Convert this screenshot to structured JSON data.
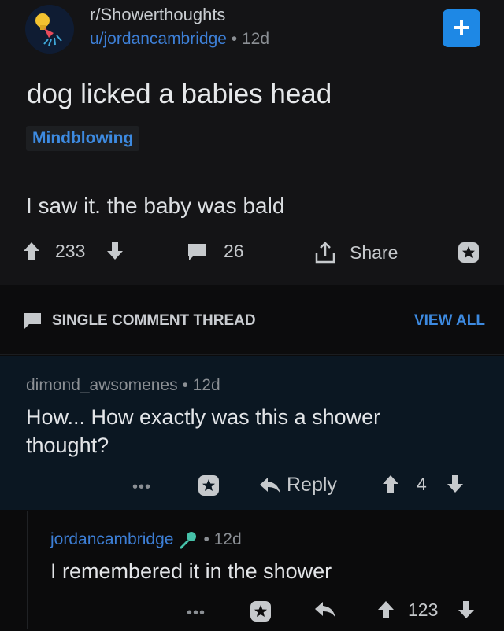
{
  "post": {
    "subreddit": "r/Showerthoughts",
    "username": "u/jordancambridge",
    "age": "• 12d",
    "add_label": "+",
    "title": "dog licked a babies head",
    "flair": "Mindblowing",
    "body": "I saw it. the baby was bald",
    "upvotes": "233",
    "comments": "26",
    "share_label": "Share"
  },
  "thread_bar": {
    "label": "SINGLE COMMENT THREAD",
    "view_all": "VIEW ALL"
  },
  "comment1": {
    "author": "dimond_awsomenes",
    "age": "• 12d",
    "text_line1": "How... How exactly was this a shower",
    "text_line2": "thought?",
    "more": "•••",
    "reply_label": "Reply",
    "score": "4"
  },
  "comment2": {
    "author": "jordancambridge",
    "age": "• 12d",
    "text": "I remembered it in the shower",
    "more": "•••",
    "score": "123"
  },
  "colors": {
    "accent": "#1e88e5",
    "link": "#3d7fd6",
    "background": "#0b0b0c",
    "post_bg": "#141416",
    "comment_highlight_bg": "#0b1722"
  },
  "icons": [
    "showerhead-avatar-icon",
    "add-icon",
    "upvote-icon",
    "downvote-icon",
    "comment-icon",
    "share-icon",
    "star-icon",
    "reply-icon",
    "mod-mic-icon"
  ]
}
